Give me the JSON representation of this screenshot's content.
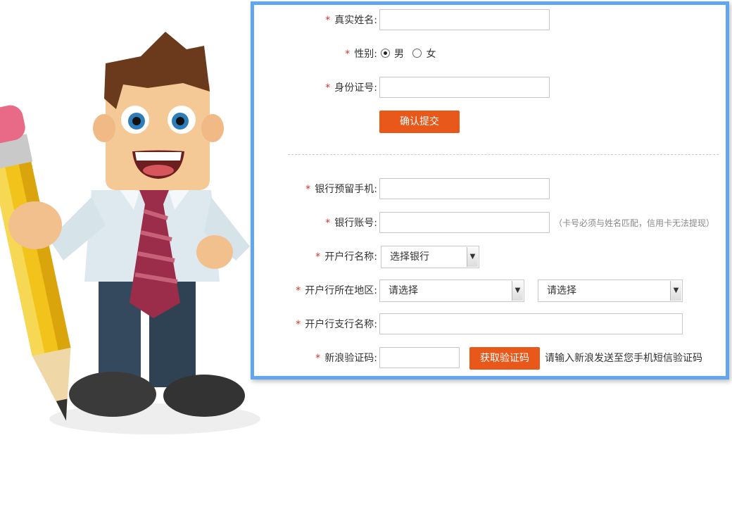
{
  "form": {
    "name_label": "真实姓名:",
    "gender_label": "性别:",
    "gender_male": "男",
    "gender_female": "女",
    "id_label": "身份证号:",
    "submit_label": "确认提交",
    "phone_label": "银行预留手机:",
    "account_label": "银行账号:",
    "account_hint": "（卡号必须与姓名匹配，信用卡无法提现）",
    "bank_label": "开户行名称:",
    "bank_select": "选择银行",
    "region_label": "开户行所在地区:",
    "region_select1": "请选择",
    "region_select2": "请选择",
    "branch_label": "开户行支行名称:",
    "code_label": "新浪验证码:",
    "code_button": "获取验证码",
    "code_hint": "请输入新浪发送至您手机短信验证码",
    "required_mark": "*"
  },
  "icons": {
    "dropdown": "▼"
  },
  "colors": {
    "accent": "#e8581a",
    "panel_border": "#62a6f0",
    "required": "#d9342b"
  }
}
